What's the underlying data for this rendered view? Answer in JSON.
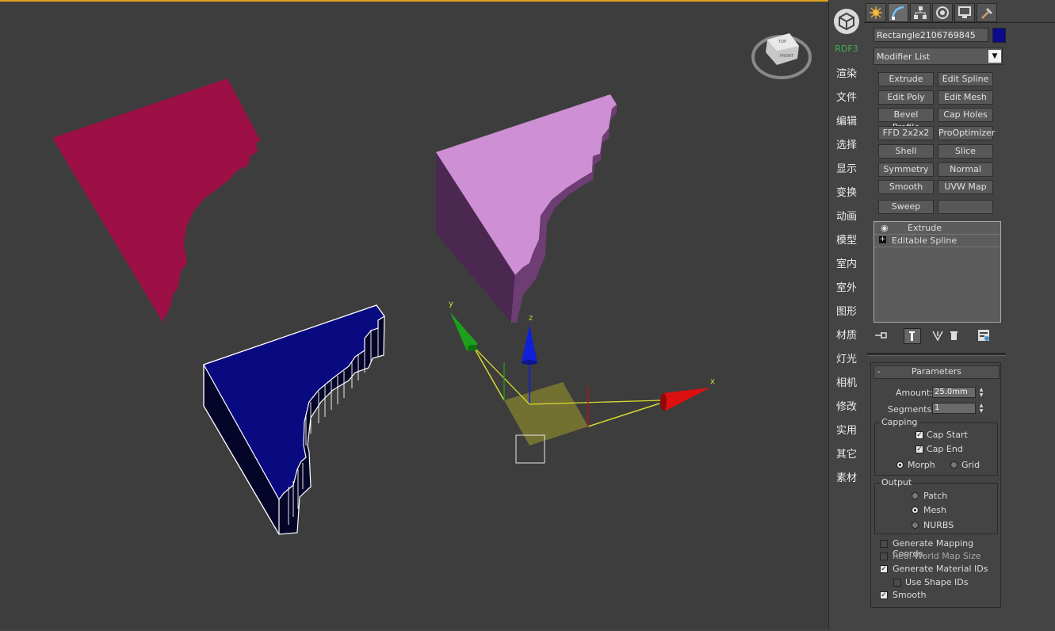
{
  "toolstrip": {
    "rdf": "RDF3",
    "items": [
      "渲染",
      "文件",
      "编辑",
      "选择",
      "显示",
      "变换",
      "动画",
      "模型",
      "室内",
      "室外",
      "图形",
      "材质",
      "灯光",
      "相机",
      "修改",
      "实用",
      "其它",
      "素材"
    ]
  },
  "viewport": {
    "viewcube": {
      "top": "TOP",
      "front": "FRONT"
    },
    "gizmo": {
      "x": "x",
      "y": "y",
      "z": "z"
    },
    "colors": {
      "maroon": "#9c1046",
      "pink": "#cf8fd4",
      "blue": "#0a0a80",
      "gizmo_plane": "#7d7a30",
      "axis_x": "#e01010",
      "axis_y": "#1ca01c",
      "axis_z": "#1020d8"
    }
  },
  "panel": {
    "tabs": [
      "create-icon",
      "modify-icon",
      "hierarchy-icon",
      "motion-icon",
      "display-icon",
      "utilities-icon"
    ],
    "object_name": "Rectangle2106769845",
    "object_color": "#0a0a8c",
    "modifier_list": "Modifier List",
    "modifier_buttons": [
      [
        "Extrude",
        "Edit Spline"
      ],
      [
        "Edit Poly",
        "Edit Mesh"
      ],
      [
        "Bevel Profile",
        "Cap Holes"
      ],
      [
        "FFD 2x2x2",
        "ProOptimizer"
      ],
      [
        "Shell",
        "Slice"
      ],
      [
        "Symmetry",
        "Normal"
      ],
      [
        "Smooth",
        "UVW Map"
      ],
      [
        "Sweep",
        ""
      ]
    ],
    "stack": [
      "Extrude",
      "Editable Spline"
    ],
    "parameters": {
      "title": "Parameters",
      "amount_label": "Amount:",
      "amount": "25.0mm",
      "segments_label": "Segments:",
      "segments": "1",
      "capping": {
        "title": "Capping",
        "cap_start": "Cap Start",
        "cap_end": "Cap End",
        "morph": "Morph",
        "grid": "Grid"
      },
      "output": {
        "title": "Output",
        "patch": "Patch",
        "mesh": "Mesh",
        "nurbs": "NURBS"
      },
      "gen_mapping": "Generate Mapping Coords.",
      "real_world": "Real-World Map Size",
      "gen_material": "Generate Material IDs",
      "use_shape": "Use Shape IDs",
      "smooth": "Smooth"
    }
  }
}
